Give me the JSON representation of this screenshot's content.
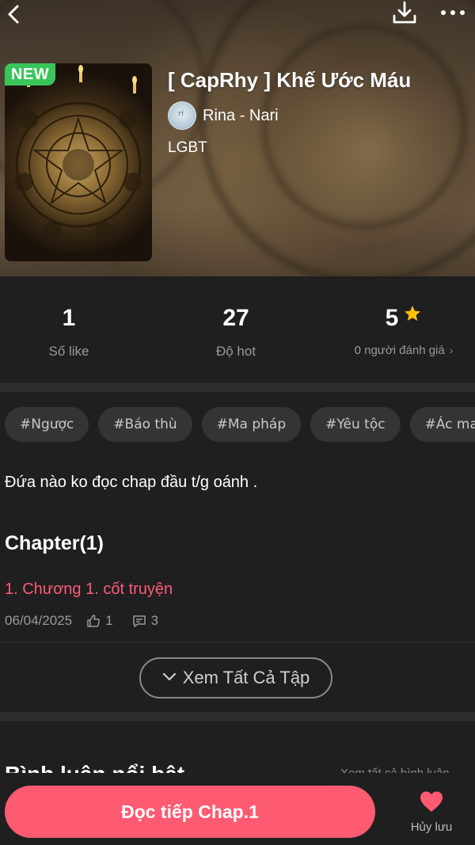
{
  "header": {
    "back_icon": "chevron-left-icon",
    "download_icon": "download-icon",
    "more_icon": "more-horizontal-icon"
  },
  "book": {
    "badge": "NEW",
    "title": "[ CapRhy ] Khế Ước Máu",
    "author": "Rina - Nari",
    "genre": "LGBT",
    "description": "Đứa nào ko đọc chap đầu t/g oánh ."
  },
  "stats": {
    "likes": {
      "value": "1",
      "label": "Số like"
    },
    "hot": {
      "value": "27",
      "label": "Độ hot"
    },
    "rating": {
      "value": "5",
      "label": "0 người đánh giá",
      "star_color": "#ffc107"
    }
  },
  "tags": [
    "#Ngược",
    "#Báo thù",
    "#Ma pháp",
    "#Yêu tộc",
    "#Ác ma"
  ],
  "chapters": {
    "heading": "Chapter(1)",
    "items": [
      {
        "title": "1. Chương 1. cốt truyện",
        "date": "06/04/2025",
        "likes": "1",
        "comments": "3"
      }
    ],
    "view_all_label": "Xem Tất Cả Tập"
  },
  "reviews": {
    "heading_peek": "Bình luận nổi bật",
    "right_peek": "Xem tất cả bình luận"
  },
  "bottom": {
    "read_label": "Đọc tiếp Chap.1",
    "save_label": "Hủy lưu",
    "accent": "#fe5a72"
  }
}
